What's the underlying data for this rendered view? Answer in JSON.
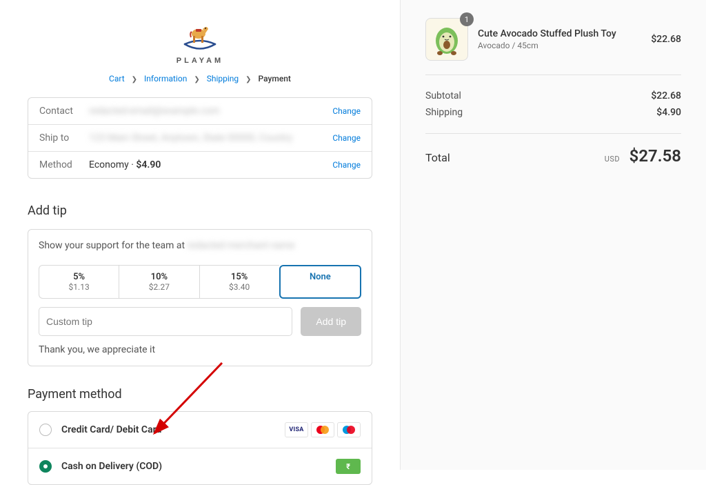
{
  "logo": {
    "text": "PLAYAM"
  },
  "breadcrumb": {
    "cart": "Cart",
    "information": "Information",
    "shipping": "Shipping",
    "payment": "Payment"
  },
  "info": {
    "contact_label": "Contact",
    "contact_value": "redacted-email@example.com",
    "shipto_label": "Ship to",
    "shipto_value": "123 Main Street, Anytown, State 00000, Country",
    "method_label": "Method",
    "method_value": "Economy",
    "method_price": "$4.90",
    "change": "Change"
  },
  "tip": {
    "title": "Add tip",
    "support_prefix": "Show your support for the team at ",
    "support_name": "redacted merchant name",
    "opt1_label": "5%",
    "opt1_amt": "$1.13",
    "opt2_label": "10%",
    "opt2_amt": "$2.27",
    "opt3_label": "15%",
    "opt3_amt": "$3.40",
    "none_label": "None",
    "custom_placeholder": "Custom tip",
    "add_btn": "Add tip",
    "thanks": "Thank you, we appreciate it"
  },
  "payment": {
    "title": "Payment method",
    "card_label": "Credit Card/ Debit Card",
    "cod_label": "Cash on Delivery (COD)",
    "visa_text": "VISA",
    "cod_symbol": "₹"
  },
  "product": {
    "name": "Cute Avocado Stuffed Plush Toy",
    "variant": "Avocado / 45cm",
    "price": "$22.68",
    "qty": "1"
  },
  "summary": {
    "subtotal_label": "Subtotal",
    "subtotal_val": "$22.68",
    "shipping_label": "Shipping",
    "shipping_val": "$4.90",
    "total_label": "Total",
    "currency": "USD",
    "total_val": "$27.58"
  }
}
